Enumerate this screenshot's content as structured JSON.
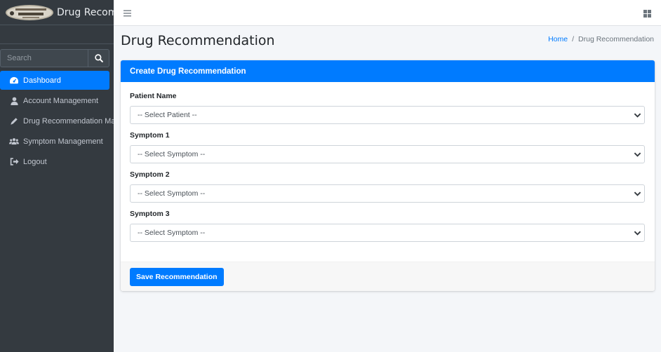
{
  "brand": {
    "name": "Drug Recommendation System",
    "logo_text": "ARTHUR W. JARVIS UNIVERSITY"
  },
  "search": {
    "placeholder": "Search"
  },
  "sidebar": {
    "items": [
      {
        "label": "Dashboard",
        "icon": "tachometer-icon",
        "active": true
      },
      {
        "label": "Account Management",
        "icon": "user-icon",
        "active": false
      },
      {
        "label": "Drug Recommendation Management",
        "icon": "pen-icon",
        "active": false
      },
      {
        "label": "Symptom Management",
        "icon": "users-icon",
        "active": false
      },
      {
        "label": "Logout",
        "icon": "sign-out-icon",
        "active": false
      }
    ]
  },
  "header": {
    "title": "Drug Recommendation",
    "breadcrumb": {
      "home": "Home",
      "separator": "/",
      "current": "Drug Recommendation"
    }
  },
  "card": {
    "title": "Create Drug Recommendation",
    "fields": [
      {
        "label": "Patient Name",
        "value": "-- Select Patient --"
      },
      {
        "label": "Symptom 1",
        "value": "-- Select Symptom --"
      },
      {
        "label": "Symptom 2",
        "value": "-- Select Symptom --"
      },
      {
        "label": "Symptom 3",
        "value": "-- Select Symptom --"
      }
    ],
    "submit_label": "Save Recommendation"
  },
  "colors": {
    "primary": "#007bff",
    "sidebar": "#343a40",
    "background": "#f4f6f9"
  }
}
